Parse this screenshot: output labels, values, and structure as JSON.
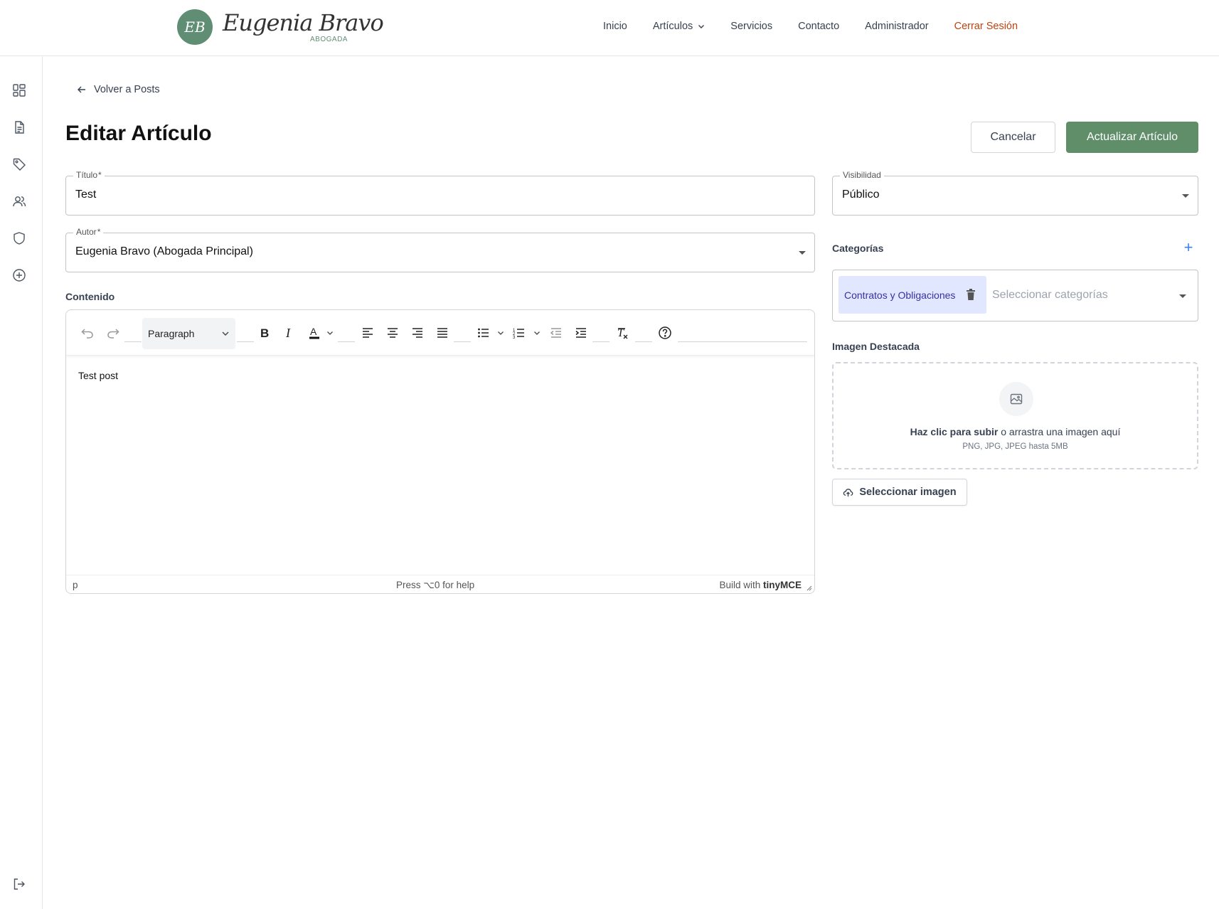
{
  "brand": {
    "monogram": "EB",
    "name_script": "Eugenia Bravo",
    "subtitle": "ABOGADA",
    "color": "#5f8e74"
  },
  "nav": {
    "items": [
      {
        "label": "Inicio",
        "icon": null
      },
      {
        "label": "Artículos",
        "icon": "chevron-down-icon"
      },
      {
        "label": "Servicios",
        "icon": null
      },
      {
        "label": "Contacto",
        "icon": null
      },
      {
        "label": "Administrador",
        "icon": null
      },
      {
        "label": "Cerrar Sesión",
        "icon": null,
        "color": "#c2410c"
      }
    ]
  },
  "sidebar": {
    "icons": [
      "dashboard-icon",
      "document-icon",
      "tag-icon",
      "users-icon",
      "shield-icon",
      "plus-circle-icon"
    ],
    "bottom_icon": "logout-icon"
  },
  "header": {
    "back_label": "Volver a Posts",
    "page_title": "Editar Artículo",
    "cancel_label": "Cancelar",
    "update_label": "Actualizar Artículo",
    "update_color": "#5f8e68"
  },
  "form": {
    "title_label": "Título",
    "title_required": "*",
    "title_value": "Test",
    "author_label": "Autor",
    "author_required": "*",
    "author_value": "Eugenia Bravo (Abogada Principal)",
    "content_label": "Contenido",
    "visibility_label": "Visibilidad",
    "visibility_value": "Público",
    "categories_label": "Categorías",
    "categories_selected": [
      "Contratos y Obligaciones"
    ],
    "categories_placeholder": "Seleccionar categorías",
    "image_label": "Imagen Destacada"
  },
  "editor": {
    "block_format": "Paragraph",
    "body_text": "Test post",
    "status_path": "p",
    "status_help": "Press ⌥0 for help",
    "status_brand_prefix": "Build with",
    "status_brand_name": "tinyMCE",
    "toolbar_icons": [
      "undo-icon",
      "redo-icon",
      "bold-icon",
      "italic-icon",
      "text-color-icon",
      "align-left-icon",
      "align-center-icon",
      "align-right-icon",
      "align-justify-icon",
      "bullet-list-icon",
      "numbered-list-icon",
      "outdent-icon",
      "indent-icon",
      "clear-format-icon",
      "help-icon"
    ]
  },
  "upload": {
    "text_bold": "Haz clic para subir",
    "text_rest": "o arrastra una imagen aquí",
    "hint": "PNG, JPG, JPEG hasta 5MB",
    "button_label": "Seleccionar imagen"
  }
}
